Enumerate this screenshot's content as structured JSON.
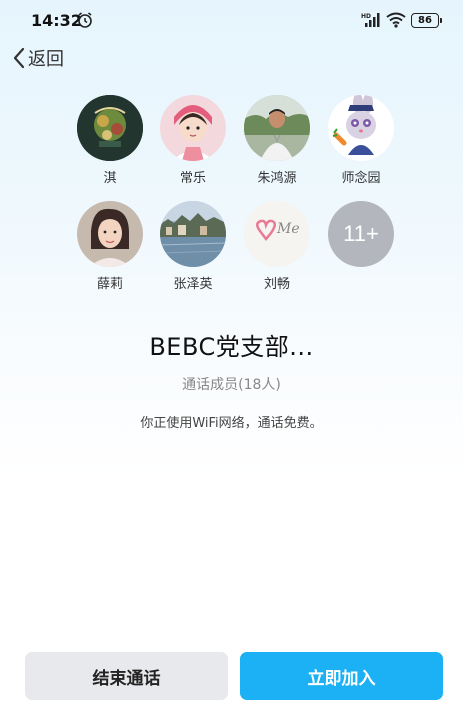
{
  "status_bar": {
    "time": "14:32",
    "battery": "86",
    "icons": [
      "alarm-icon",
      "hd-signal-icon",
      "wifi-icon",
      "battery-icon"
    ]
  },
  "nav": {
    "back_label": "返回"
  },
  "members": [
    {
      "name": "淇"
    },
    {
      "name": "常乐"
    },
    {
      "name": "朱鸿源"
    },
    {
      "name": "师念园"
    },
    {
      "name": "薛莉"
    },
    {
      "name": "张泽英"
    },
    {
      "name": "刘畅"
    }
  ],
  "more_members": "11+",
  "group": {
    "title": "BEBC党支部...",
    "member_count": "通话成员(18人)",
    "notice": "你正使用WiFi网络，通话免费。"
  },
  "actions": {
    "end_label": "结束通话",
    "join_label": "立即加入"
  },
  "colors": {
    "primary": "#1cb1f4",
    "secondary_button": "#e8e9ec",
    "more_badge": "#b3b7bd"
  }
}
